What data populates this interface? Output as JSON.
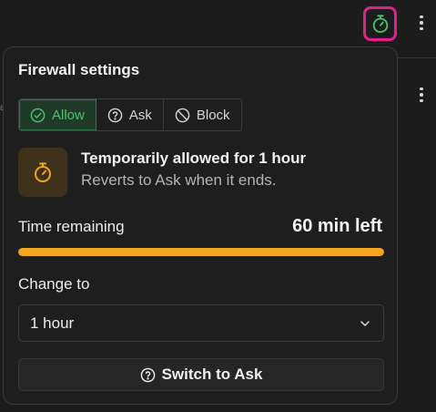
{
  "icons": {
    "timer": "stopwatch-icon",
    "more": "more-vertical-icon",
    "allow": "check-circle-icon",
    "ask": "help-circle-icon",
    "block": "ban-icon",
    "select": "chevron-down-icon",
    "switch": "help-circle-icon"
  },
  "colors": {
    "accent_green": "#4cc368",
    "highlight_pink": "#e0218a",
    "timer_orange": "#f3a51f"
  },
  "popover": {
    "title": "Firewall settings",
    "modes": [
      {
        "label": "Allow",
        "active": true
      },
      {
        "label": "Ask",
        "active": false
      },
      {
        "label": "Block",
        "active": false
      }
    ],
    "status": {
      "title": "Temporarily allowed for 1 hour",
      "subtitle": "Reverts to Ask when it ends."
    },
    "time": {
      "label": "Time remaining",
      "value": "60 min left",
      "progress_fraction": 1.0
    },
    "change": {
      "label": "Change to",
      "selected": "1 hour"
    },
    "switch_button": "Switch to Ask"
  }
}
